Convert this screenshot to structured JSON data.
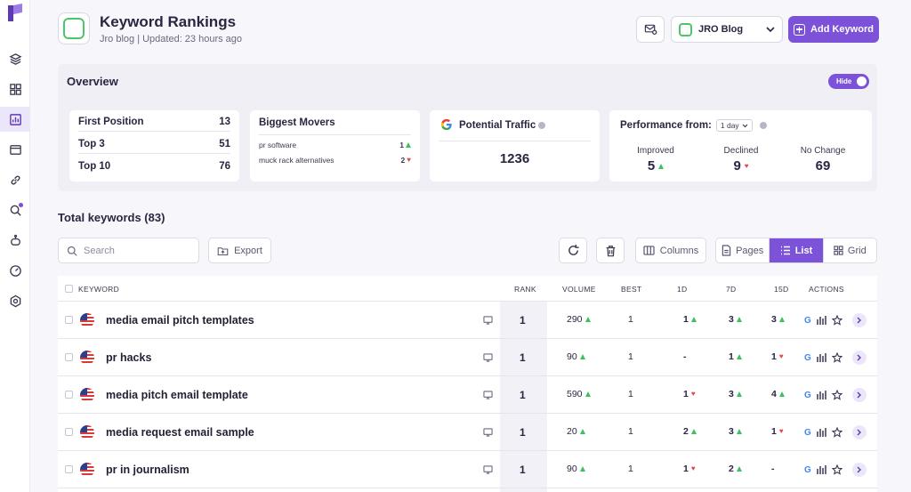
{
  "header": {
    "title": "Keyword Rankings",
    "subtitle": "Jro blog | Updated: 23 hours ago",
    "project": "JRO Blog",
    "add_keyword": "Add Keyword"
  },
  "overview": {
    "title": "Overview",
    "hide_label": "Hide",
    "positions": [
      {
        "label": "First Position",
        "value": "13"
      },
      {
        "label": "Top 3",
        "value": "51"
      },
      {
        "label": "Top 10",
        "value": "76"
      }
    ],
    "movers": {
      "title": "Biggest Movers",
      "items": [
        {
          "keyword": "pr software",
          "value": "1",
          "dir": "up"
        },
        {
          "keyword": "muck rack alternatives",
          "value": "2",
          "dir": "down"
        }
      ]
    },
    "traffic": {
      "title": "Potential Traffic",
      "value": "1236"
    },
    "performance": {
      "title": "Performance from:",
      "period": "1 day",
      "improved_label": "Improved",
      "improved": "5",
      "declined_label": "Declined",
      "declined": "9",
      "nochange_label": "No Change",
      "nochange": "69"
    }
  },
  "toolbar": {
    "total": "Total keywords (83)",
    "search_placeholder": "Search",
    "export": "Export",
    "columns": "Columns",
    "pages": "Pages",
    "list": "List",
    "grid": "Grid"
  },
  "table": {
    "headers": {
      "keyword": "KEYWORD",
      "rank": "RANK",
      "volume": "VOLUME",
      "best": "BEST",
      "d1": "1D",
      "d7": "7D",
      "d15": "15D",
      "actions": "ACTIONS"
    },
    "rows": [
      {
        "keyword": "media email pitch templates",
        "rank": "1",
        "volume": "290",
        "best": "1",
        "d1": "1",
        "d1dir": "up",
        "d7": "3",
        "d7dir": "up",
        "d15": "3",
        "d15dir": "up"
      },
      {
        "keyword": "pr hacks",
        "rank": "1",
        "volume": "90",
        "best": "1",
        "d1": "-",
        "d1dir": "",
        "d7": "1",
        "d7dir": "up",
        "d15": "1",
        "d15dir": "down"
      },
      {
        "keyword": "media pitch email template",
        "rank": "1",
        "volume": "590",
        "best": "1",
        "d1": "1",
        "d1dir": "down",
        "d7": "3",
        "d7dir": "up",
        "d15": "4",
        "d15dir": "up"
      },
      {
        "keyword": "media request email sample",
        "rank": "1",
        "volume": "20",
        "best": "1",
        "d1": "2",
        "d1dir": "up",
        "d7": "3",
        "d7dir": "up",
        "d15": "1",
        "d15dir": "down"
      },
      {
        "keyword": "pr in journalism",
        "rank": "1",
        "volume": "90",
        "best": "1",
        "d1": "1",
        "d1dir": "down",
        "d7": "2",
        "d7dir": "up",
        "d15": "-",
        "d15dir": ""
      }
    ]
  },
  "colors": {
    "accent": "#7c52d9",
    "up": "#3fbf5e",
    "down": "#e04848",
    "brand_green": "#4fc46d"
  }
}
